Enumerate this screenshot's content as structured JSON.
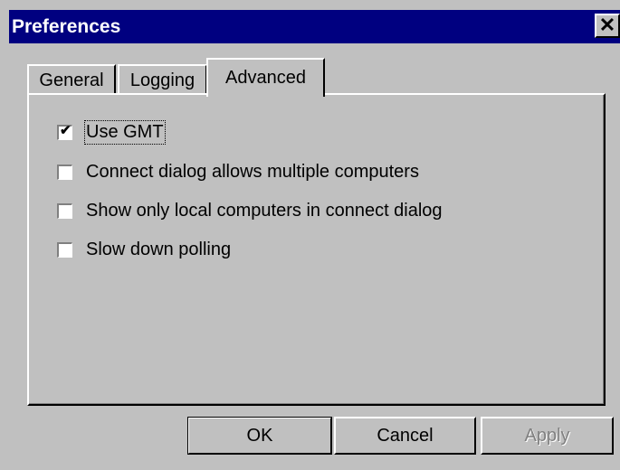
{
  "window": {
    "title": "Preferences",
    "close_symbol": "✕"
  },
  "tabs": [
    {
      "label": "General"
    },
    {
      "label": "Logging"
    },
    {
      "label": "Advanced",
      "selected": true
    }
  ],
  "options": [
    {
      "label": "Use GMT",
      "checked": true
    },
    {
      "label": "Connect dialog allows multiple computers",
      "checked": false
    },
    {
      "label": "Show only local computers in connect dialog",
      "checked": false
    },
    {
      "label": "Slow down polling",
      "checked": false
    }
  ],
  "buttons": {
    "ok": "OK",
    "cancel": "Cancel",
    "apply": "Apply"
  },
  "colors": {
    "titlebar": "#000080",
    "face": "#c0c0c0"
  }
}
